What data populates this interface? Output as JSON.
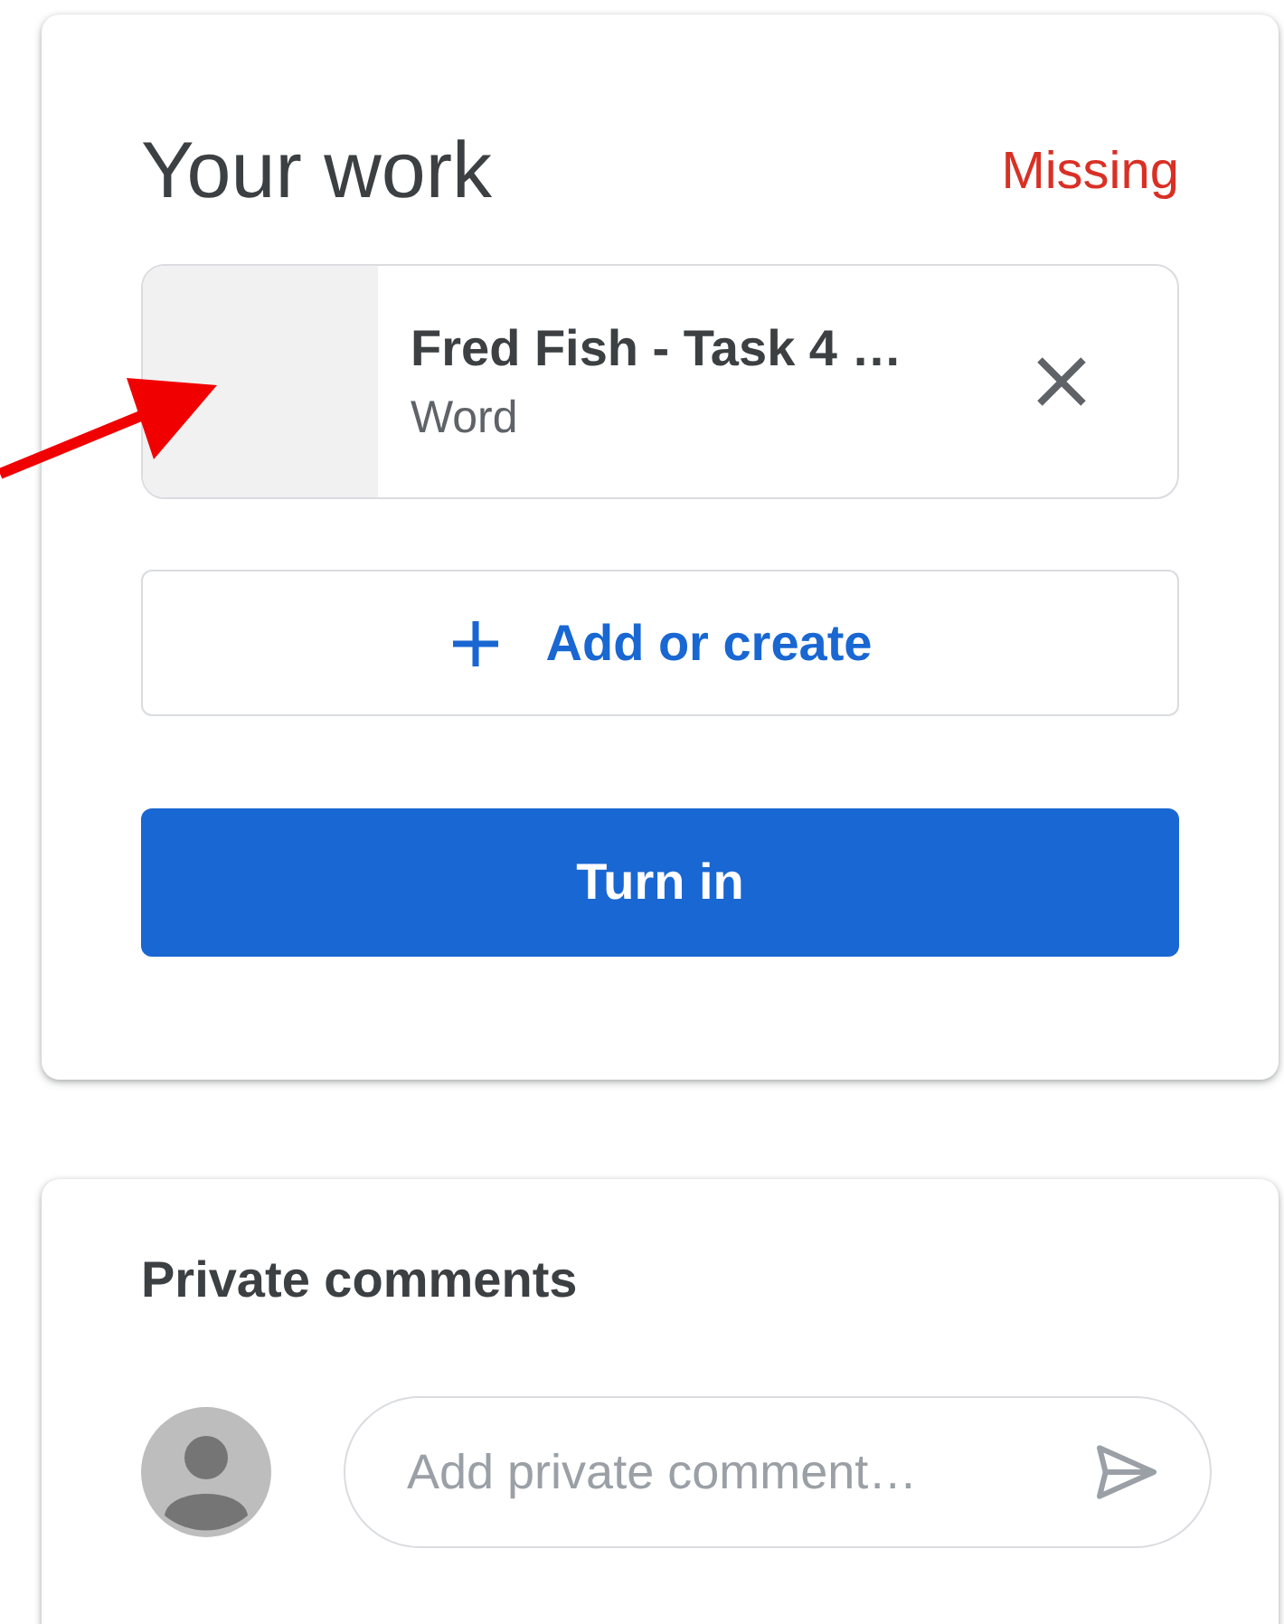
{
  "your_work": {
    "title": "Your work",
    "status": "Missing",
    "attachments": [
      {
        "title": "Fred Fish - Task 4 …",
        "type": "Word"
      }
    ],
    "add_button": "Add or create",
    "turn_in_button": "Turn in"
  },
  "private_comments": {
    "title": "Private comments",
    "placeholder": "Add private comment…"
  }
}
